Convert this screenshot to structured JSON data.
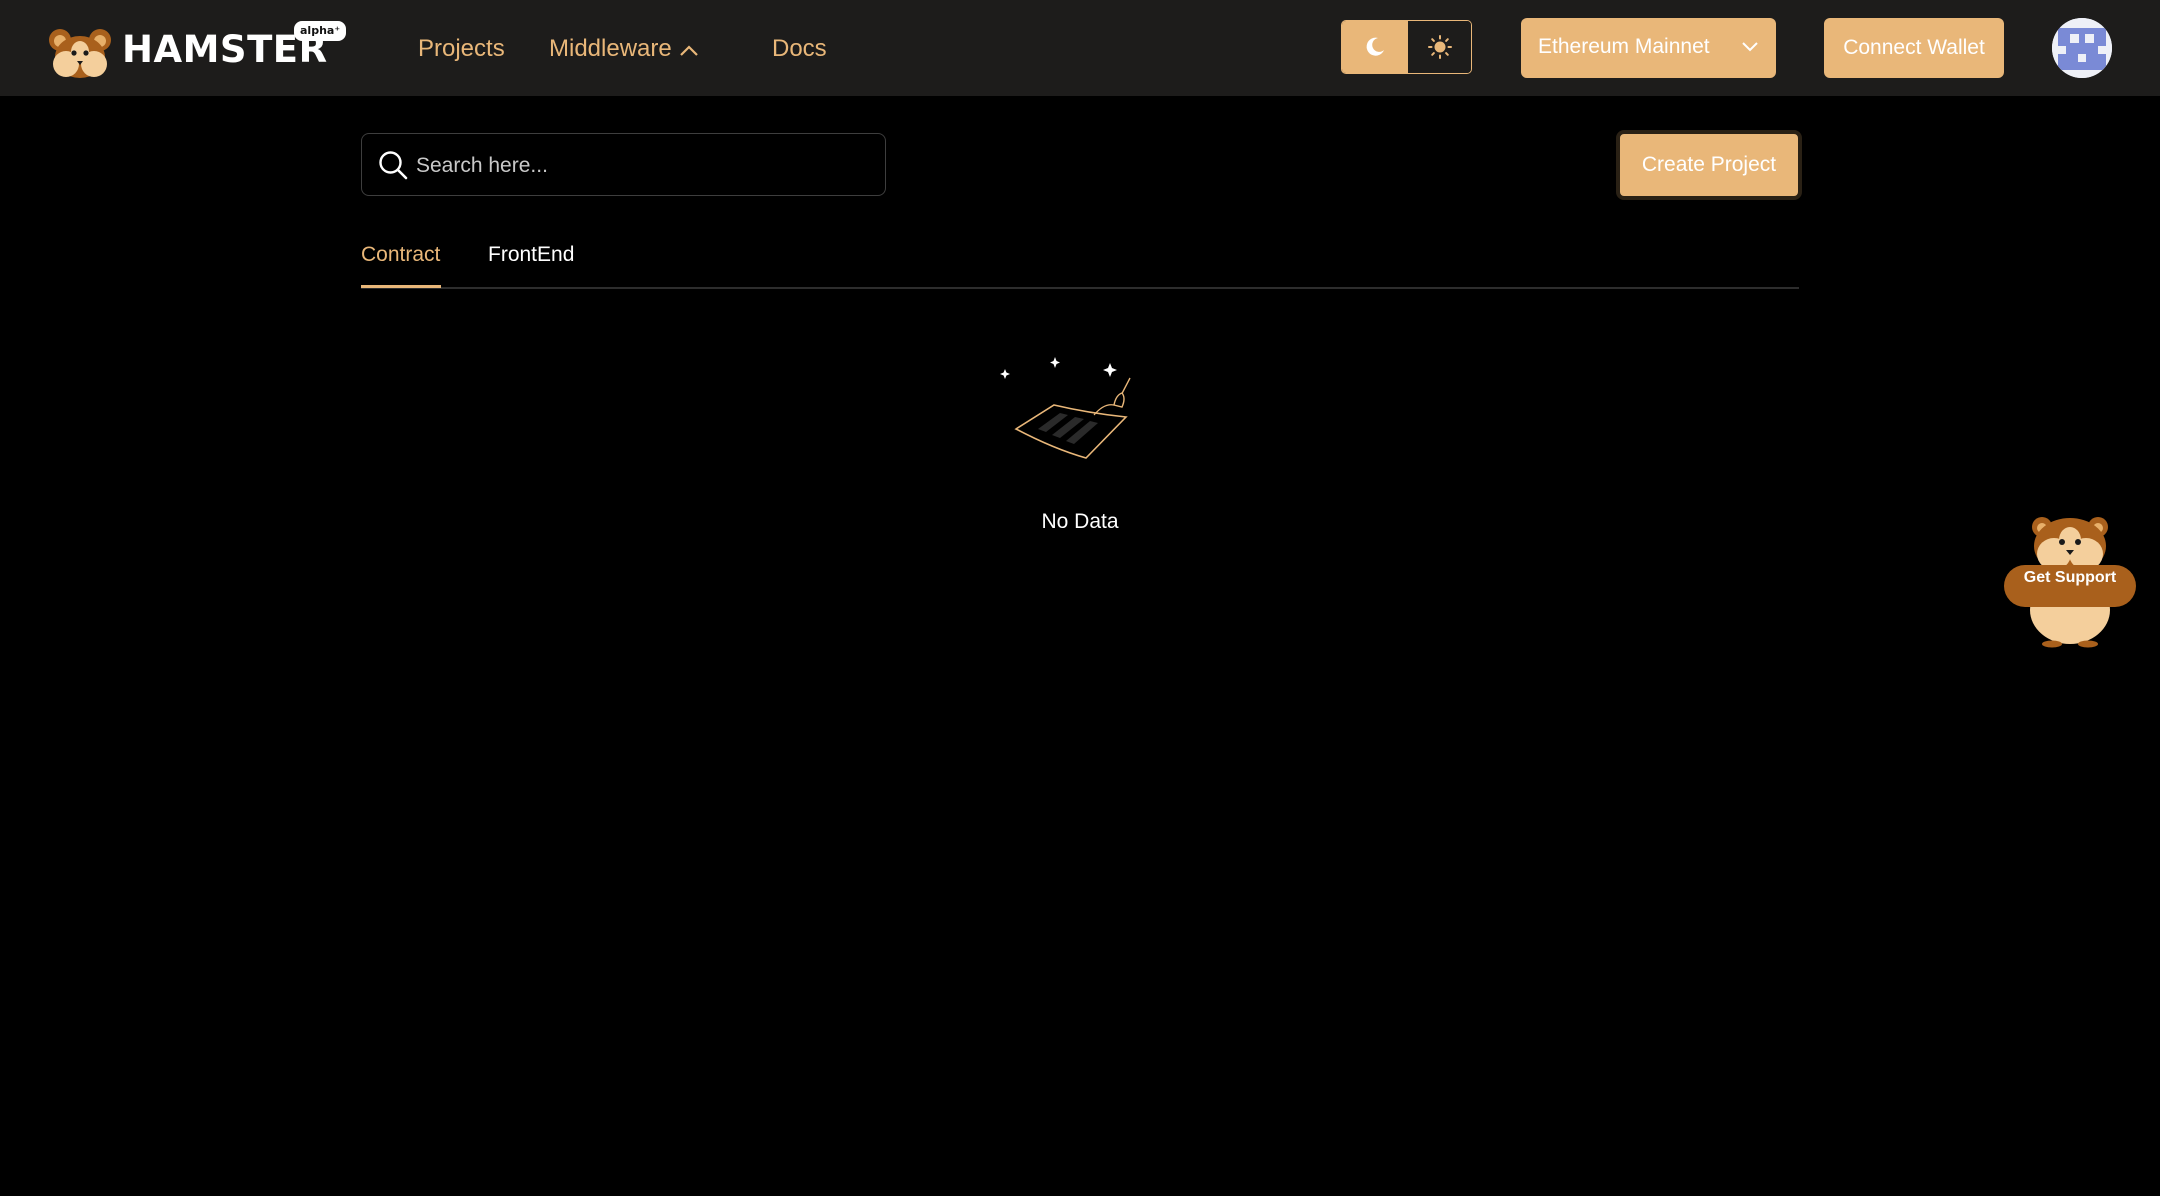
{
  "brand": {
    "name": "HAMSTER",
    "badge": "alpha⁺"
  },
  "nav": {
    "projects": "Projects",
    "middleware": "Middleware",
    "docs": "Docs"
  },
  "theme": {
    "active": "dark"
  },
  "network": {
    "selected": "Ethereum Mainnet"
  },
  "header": {
    "connect_wallet": "Connect Wallet"
  },
  "search": {
    "placeholder": "Search here..."
  },
  "actions": {
    "create_project": "Create Project"
  },
  "tabs": [
    {
      "label": "Contract",
      "active": true
    },
    {
      "label": "FrontEnd",
      "active": false
    }
  ],
  "empty_state": {
    "text": "No Data"
  },
  "support": {
    "label": "Get Support"
  },
  "colors": {
    "accent": "#e9b779",
    "header_bg": "#1d1c1b",
    "page_bg": "#000000",
    "mascot_dark": "#a9601c",
    "mascot_light": "#f4cf9c"
  },
  "icons": {
    "logo": "hamster-logo-icon",
    "middleware_caret": "chevron-up-icon",
    "dark_mode": "moon-icon",
    "light_mode": "sun-icon",
    "network_caret": "chevron-down-icon",
    "search": "search-icon",
    "empty": "empty-box-icon",
    "support": "hamster-mascot-icon"
  }
}
